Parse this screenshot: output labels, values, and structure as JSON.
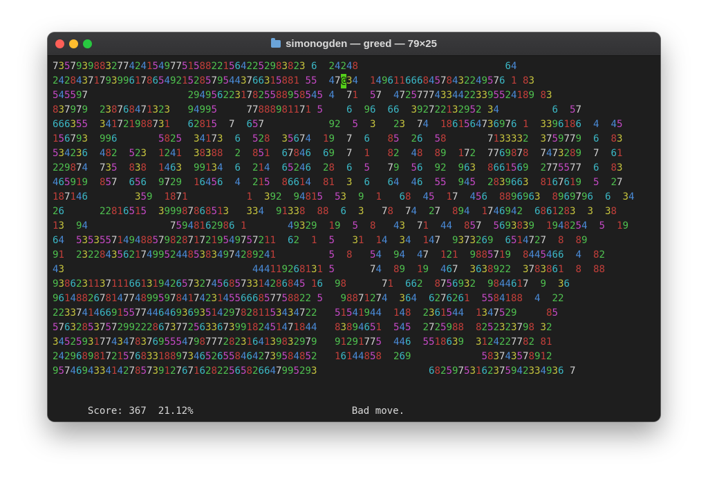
{
  "window": {
    "title": "simonogden — greed — 79×25"
  },
  "colors": {
    "1": "#c23f3a",
    "2": "#4fc14f",
    "3": "#c6c43e",
    "4": "#4a8bd8",
    "5": "#c649c6",
    "6": "#3bb8c6",
    "7": "#d2d2d2",
    "8": "#c23f3a",
    "9": "#4fc14f",
    "player_bg": "#55d01a",
    "player_fg": "#111111"
  },
  "grid": [
    "7357939883277424154977515882215642252983823 6  24248                         64",
    "242843717939961786549215285795443766315881 55  47@34  14961166684578432249576 1 83",
    "545597                 29495622317825588958545 4  71  57  472577743344223395524189 83",
    "837979  238768471323   94995     77888981171 5    6  96  66  392722132952 34         6  57",
    "666355  341721988731   62815  7  657           92  5  3   23  74  1861564736976 1  3396186  4  45",
    "156793  996       5825  34173  6  528  35674  19  7  6   85  26  58       7133332  3759779  6  83",
    "534236  482  523  1241  38388  2  851  67846  69  7  1   82  48  89  172  7769878  7473289  7  61",
    "229874  735  838  1463  99134  6  214  65246  28  6  5   79  56  92  963  8661569  2775577  6  83",
    "465919  857  656  9729  16456  4  215  86614  81  3  6   64  46  55  945  2839663  8167619  5  27",
    "187146        359  1871          1  392  94815  53  9  1   68  45  17  456  8896963  8969796  6  34",
    "26      22816515  399987868513   334  91338  88  6  3   78  74  27  894  1746942  6861283  3  38",
    "13  94              75948162986 1       49329  19  5  8   43  71  44  857  5693839  1948254  5  19",
    "64  5353557149488579828717219549757211  62  1  5   31  14  34  147  9373269  6514727  8  89",
    "91  2322843562174995244853834974289241         5  8   54  94  47  121  9885719  8445466  4  82",
    "43                                444119268131 5      74  89  19  467  3638922  3783861  8  88",
    "9386231137111661319426573274568573314286845 16  98      71  662  8756932  9844617  9  36",
    "96148826781477489959784174231455666857758822 5   98871274  364  6276261  5584188  4  22",
    "223374146691557744646936935142978281153434722   51541944  148  2361544  1347529     85",
    "576328537572992228673772563367399182451471844   83894651  545  2725988  8252323798 32",
    "345259317743478376955547987772823164139832979   91291775  446  5518639  3124227782 81",
    "242968981721576833188973465265584642739584852   16144858  269            583743578912",
    "957469433414278573912767162822565826647995293                   68259753162375942334936 7"
  ],
  "status": {
    "score_text": "Score: 367  21.12%",
    "message": "Bad move."
  }
}
